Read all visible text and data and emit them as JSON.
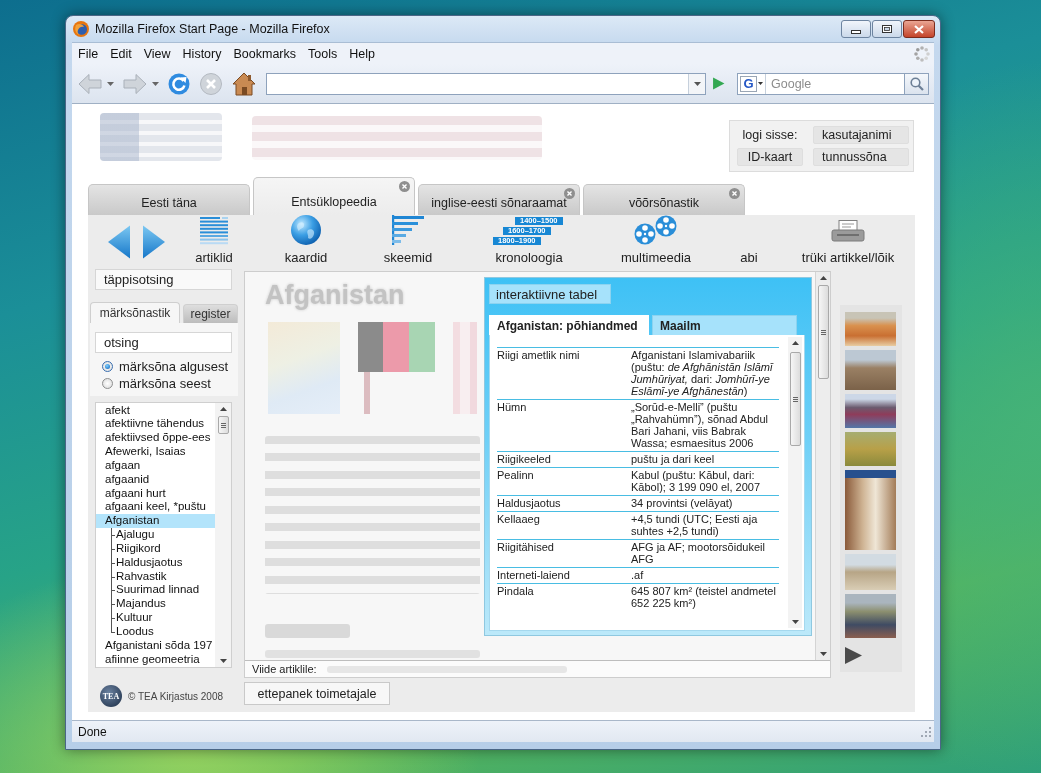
{
  "window": {
    "title": "Mozilla Firefox Start Page - Mozilla Firefox"
  },
  "menu": [
    "File",
    "Edit",
    "View",
    "History",
    "Bookmarks",
    "Tools",
    "Help"
  ],
  "nav_buttons": [
    {
      "kind": "back",
      "disabled": true
    },
    {
      "kind": "forward",
      "disabled": true
    },
    {
      "kind": "reload",
      "disabled": false
    },
    {
      "kind": "stop",
      "disabled": true
    },
    {
      "kind": "home",
      "disabled": false
    }
  ],
  "search": {
    "engine": "G",
    "placeholder": "Google"
  },
  "login": {
    "label": "logi sisse:",
    "username": {
      "placeholder": "kasutajanimi"
    },
    "id_card": "ID-kaart",
    "password": {
      "placeholder": "tunnussõna"
    }
  },
  "site_tabs": [
    {
      "label": "Eesti täna",
      "selected": false,
      "closable": false
    },
    {
      "label": "Entsüklopeedia",
      "selected": true,
      "closable": true
    },
    {
      "label": "inglise-eesti sõnaraamat",
      "selected": false,
      "closable": true
    },
    {
      "label": "võõrsõnastik",
      "selected": false,
      "closable": true
    }
  ],
  "tools": [
    {
      "kind": "back"
    },
    {
      "kind": "forward"
    },
    {
      "kind": "articles",
      "label": "artiklid"
    },
    {
      "kind": "maps",
      "label": "kaardid"
    },
    {
      "kind": "diagrams",
      "label": "skeemid"
    },
    {
      "kind": "chronology",
      "label": "kronoloogia",
      "periods": [
        "1400–1500",
        "1600–1700",
        "1800–1900"
      ]
    },
    {
      "kind": "multimedia",
      "label": "multimeedia"
    },
    {
      "kind": "help",
      "label": "abi"
    },
    {
      "kind": "print",
      "label": "trüki artikkel/lõik"
    }
  ],
  "sidebar": {
    "precise_search": "täppisotsing",
    "tabs": [
      {
        "label": "märksõnastik",
        "selected": true
      },
      {
        "label": "register",
        "selected": false
      }
    ],
    "search": {
      "placeholder": "otsing"
    },
    "match_options": [
      {
        "label": "märksõna algusest",
        "selected": true
      },
      {
        "label": "märksõna seest",
        "selected": false
      }
    ],
    "keywords": [
      {
        "label": "afekt",
        "selected": false
      },
      {
        "label": "afektiivne tähendus",
        "selected": false
      },
      {
        "label": "afektiivsed õppe-ees",
        "selected": false
      },
      {
        "label": "Afewerki, Isaias",
        "selected": false
      },
      {
        "label": "afgaan",
        "selected": false
      },
      {
        "label": "afgaanid",
        "selected": false
      },
      {
        "label": "afgaani hurt",
        "selected": false
      },
      {
        "label": "afgaani keel, *puštu",
        "selected": false
      },
      {
        "label": "Afganistan",
        "selected": true,
        "children": [
          {
            "label": "Ajalugu",
            "selected": false
          },
          {
            "label": "Riigikord",
            "selected": false
          },
          {
            "label": "Haldusjaotus",
            "selected": false
          },
          {
            "label": "Rahvastik",
            "selected": false
          },
          {
            "label": "Suurimad linnad",
            "selected": false
          },
          {
            "label": "Majandus",
            "selected": false
          },
          {
            "label": "Kultuur",
            "selected": false
          },
          {
            "label": "Loodus",
            "selected": false
          }
        ]
      },
      {
        "label": "Afganistani sõda 197",
        "selected": false
      },
      {
        "label": "afiinne geomeetria",
        "selected": false
      }
    ],
    "logo": "TEA",
    "footer": "© TEA Kirjastus 2008"
  },
  "article": {
    "heading": "Afganistan",
    "link_label": "Viide artiklile:",
    "suggest_button": "ettepanek toimetajale"
  },
  "info_table": {
    "title": "interaktiivne tabel",
    "tabs": [
      {
        "label": "Afganistan: põhiandmed",
        "selected": true
      },
      {
        "label": "Maailm",
        "selected": false
      }
    ],
    "rows": [
      {
        "label": "Riigi ametlik nimi",
        "value": "Afganistani Islamivabariik (puštu: *de Afghānistān Islāmī Jumhūriyat,* dari: *Jomhūrī-ye Eslāmī-ye Afghānestān*)"
      },
      {
        "label": "Hümn",
        "value": "„Sorūd-e-Melli” (puštu „Rahvahümn”), sõnad Abdul Bari Jahani, viis Babrak Wassa; esmaesitus 2006"
      },
      {
        "label": "Riigikeeled",
        "value": "puštu ja dari keel"
      },
      {
        "label": "Pealinn",
        "value": "Kabul (puštu: Kābul, dari: Kābol); 3 199 090 el, 2007"
      },
      {
        "label": "Haldusjaotus",
        "value": "34 provintsi (velāyat)"
      },
      {
        "label": "Kellaaeg",
        "value": "+4,5 tundi (UTC; Eesti aja suhtes +2,5 tundi)"
      },
      {
        "label": "Riigitähised",
        "value": "AFG ja AF; mootorsõidukeil AFG"
      },
      {
        "label": "Interneti-laiend",
        "value": ".af"
      },
      {
        "label": "Pindala",
        "value": "645 807 km² (teistel andmetel 652 225 km²)"
      }
    ]
  },
  "status_bar": {
    "text": "Done"
  }
}
